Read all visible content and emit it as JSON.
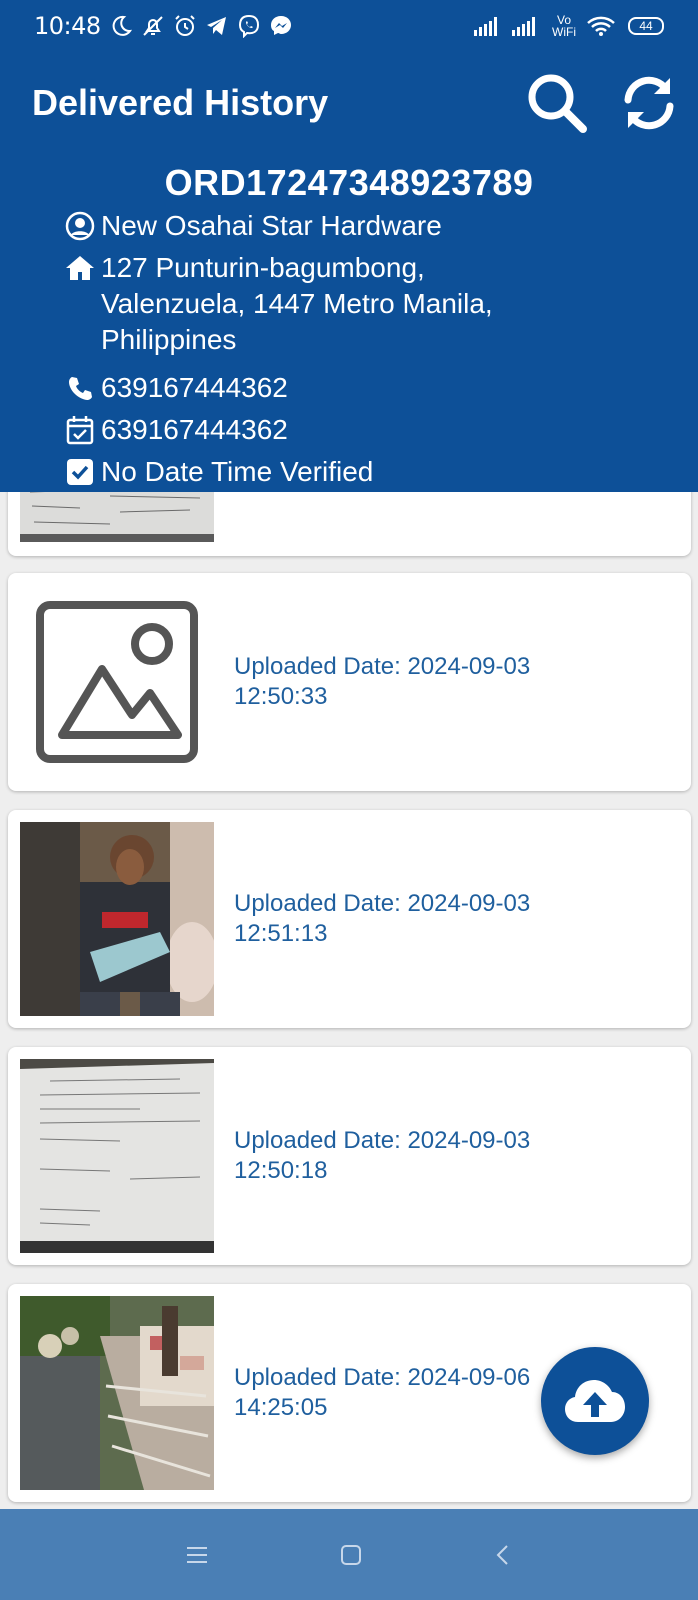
{
  "status_bar": {
    "time": "10:48",
    "network_label": "Vo WiFi",
    "battery": "44",
    "icons": [
      "moon-icon",
      "mute-icon",
      "alarm-icon",
      "telegram-icon",
      "viber-icon",
      "messenger-icon",
      "signal-icon",
      "signal-icon",
      "vowifi-icon",
      "wifi-icon",
      "battery-icon"
    ]
  },
  "header": {
    "title": "Delivered History",
    "actions": [
      "search-icon",
      "refresh-icon"
    ],
    "order_id": "ORD17247348923789",
    "customer_name": "New Osahai Star Hardware",
    "address": "127 Punturin-bagumbong, Valenzuela, 1447 Metro Manila, Philippines",
    "phone": "639167444362",
    "date_field": "639167444362",
    "verification": "No Date Time Verified"
  },
  "uploads": [
    {
      "label": "Uploaded Date: 2024-09-03",
      "time": "12:50:33",
      "image": "placeholder"
    },
    {
      "label": "Uploaded Date: 2024-09-03",
      "time": "12:51:13",
      "image": "photo-person"
    },
    {
      "label": "Uploaded Date: 2024-09-03",
      "time": "12:50:18",
      "image": "photo-document"
    },
    {
      "label": "Uploaded Date: 2024-09-06",
      "time": "14:25:05",
      "image": "photo-truck"
    }
  ],
  "fab": {
    "icon": "cloud-upload-icon"
  },
  "navbar": {
    "icons": [
      "menu-icon",
      "home-icon",
      "back-icon"
    ]
  },
  "colors": {
    "primary": "#0d5098",
    "upload_text": "#1f5f9e",
    "navbar": "#4a7fb5"
  }
}
